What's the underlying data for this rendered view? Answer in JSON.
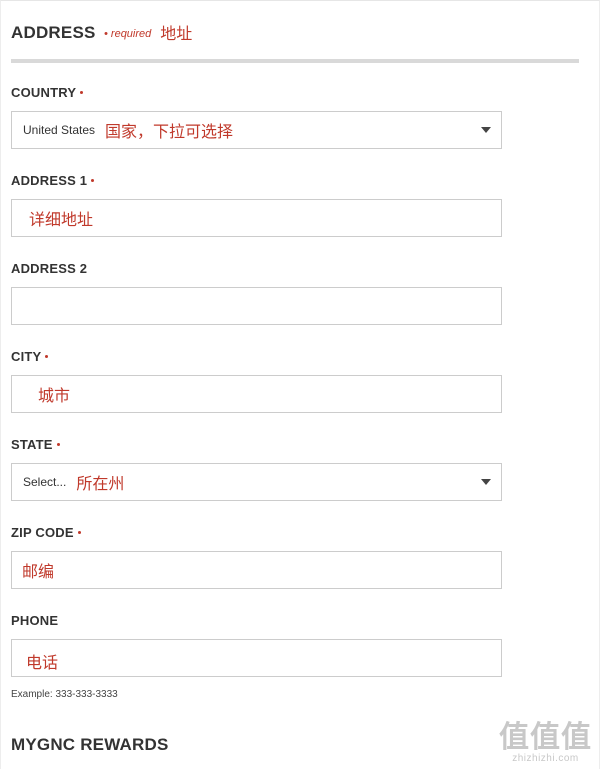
{
  "address_section": {
    "title": "ADDRESS",
    "required_note": "• required",
    "annotation": "地址"
  },
  "fields": {
    "country": {
      "label": "COUNTRY",
      "required": true,
      "value": "United States",
      "annotation": "国家，下拉可选择"
    },
    "address1": {
      "label": "ADDRESS 1",
      "required": true,
      "value": "",
      "annotation": "详细地址"
    },
    "address2": {
      "label": "ADDRESS 2",
      "required": false,
      "value": ""
    },
    "city": {
      "label": "CITY",
      "required": true,
      "value": "",
      "annotation": "城市"
    },
    "state": {
      "label": "STATE",
      "required": true,
      "value": "Select...",
      "annotation": "所在州"
    },
    "zip": {
      "label": "ZIP CODE",
      "required": true,
      "value": "",
      "annotation": "邮编"
    },
    "phone": {
      "label": "PHONE",
      "required": false,
      "value": "",
      "annotation": "电话",
      "hint": "Example: 333-333-3333"
    }
  },
  "rewards_section": {
    "title": "MYGNC REWARDS"
  },
  "watermark": {
    "glyphs": "值值值",
    "site": "zhizhizhi.com"
  },
  "colors": {
    "annotation_red": "#c0392b",
    "border": "#cccccc",
    "divider": "#d9d9d9",
    "text": "#333333"
  }
}
